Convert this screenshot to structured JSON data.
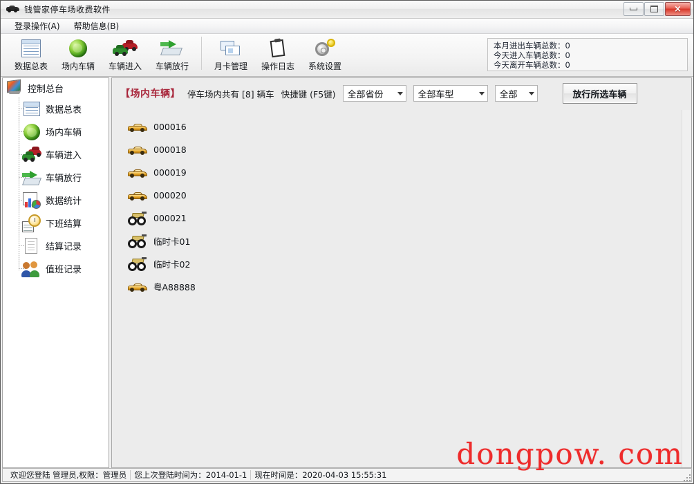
{
  "window": {
    "title": "钱管家停车场收费软件",
    "icon": "car-icon",
    "buttons": {
      "minimize": "minimize-button",
      "maximize": "maximize-button",
      "close": "×"
    }
  },
  "menubar": {
    "items": [
      {
        "label": "登录操作(A)",
        "name": "menu-login-operations"
      },
      {
        "label": "帮助信息(B)",
        "name": "menu-help-info"
      }
    ]
  },
  "toolbar": {
    "groups": [
      {
        "buttons": [
          {
            "label": "数据总表",
            "icon": "table-icon",
            "name": "toolbar-data-table"
          },
          {
            "label": "场内车辆",
            "icon": "globe-icon",
            "name": "toolbar-vehicles-in-lot"
          },
          {
            "label": "车辆进入",
            "icon": "cars-icon",
            "name": "toolbar-vehicle-entry"
          },
          {
            "label": "车辆放行",
            "icon": "pass-icon",
            "name": "toolbar-vehicle-release"
          }
        ]
      },
      {
        "buttons": [
          {
            "label": "月卡管理",
            "icon": "card-icon",
            "name": "toolbar-monthly-card"
          },
          {
            "label": "操作日志",
            "icon": "clipboard-icon",
            "name": "toolbar-operation-log"
          },
          {
            "label": "系统设置",
            "icon": "gear-icon",
            "name": "toolbar-system-settings"
          }
        ]
      }
    ],
    "stats": [
      {
        "label": "本月进出车辆总数：",
        "value": "0"
      },
      {
        "label": "今天进入车辆总数：",
        "value": "0"
      },
      {
        "label": "今天离开车辆总数：",
        "value": "0"
      }
    ]
  },
  "sidebar": {
    "root": {
      "label": "控制总台",
      "icon": "console-icon"
    },
    "items": [
      {
        "label": "数据总表",
        "icon": "table-icon",
        "name": "sidebar-item-data-table"
      },
      {
        "label": "场内车辆",
        "icon": "globe-icon",
        "name": "sidebar-item-vehicles-in-lot"
      },
      {
        "label": "车辆进入",
        "icon": "cars-icon",
        "name": "sidebar-item-vehicle-entry"
      },
      {
        "label": "车辆放行",
        "icon": "pass-icon",
        "name": "sidebar-item-vehicle-release"
      },
      {
        "label": "数据统计",
        "icon": "chart-icon",
        "name": "sidebar-item-statistics"
      },
      {
        "label": "下班结算",
        "icon": "clock-icon",
        "name": "sidebar-item-shift-settlement"
      },
      {
        "label": "结算记录",
        "icon": "document-icon",
        "name": "sidebar-item-settlement-records"
      },
      {
        "label": "值班记录",
        "icon": "people-icon",
        "name": "sidebar-item-duty-records"
      }
    ]
  },
  "content": {
    "title": "【场内车辆】",
    "subtitle": "停车场内共有 [8] 辆车",
    "hotkey": "快捷键 (F5键)",
    "filters": [
      {
        "value": "全部省份",
        "name": "filter-province"
      },
      {
        "value": "全部车型",
        "name": "filter-vehicle-type"
      },
      {
        "value": "全部",
        "name": "filter-all"
      }
    ],
    "release_button": "放行所选车辆",
    "vehicles": [
      {
        "plate": "000016",
        "icon": "gold-car-icon"
      },
      {
        "plate": "000018",
        "icon": "gold-car-icon"
      },
      {
        "plate": "000019",
        "icon": "gold-car-icon"
      },
      {
        "plate": "000020",
        "icon": "gold-car-icon"
      },
      {
        "plate": "000021",
        "icon": "motorcycle-icon"
      },
      {
        "plate": "临时卡01",
        "icon": "motorcycle-icon"
      },
      {
        "plate": "临时卡02",
        "icon": "motorcycle-icon"
      },
      {
        "plate": "粤A88888",
        "icon": "gold-car-icon"
      }
    ]
  },
  "statusbar": {
    "welcome": "欢迎您登陆 管理员,权限：管理员",
    "last_login": "您上次登陆时间为：2014-01-1",
    "current_time": "现在时间是：2020-04-03 15:55:31"
  },
  "watermark": {
    "text": "dongpow. com",
    "color": "#ee2b2b"
  }
}
